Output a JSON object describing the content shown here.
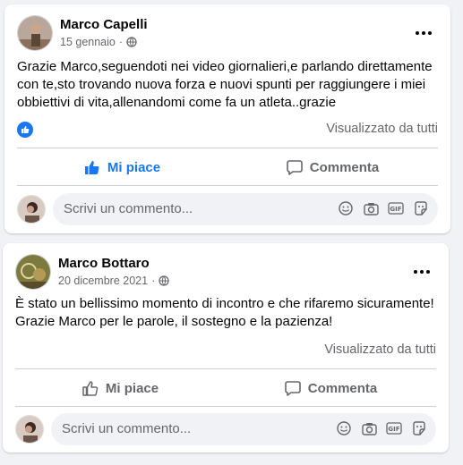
{
  "posts": [
    {
      "author": "Marco Capelli",
      "date": "15 gennaio",
      "privacy_icon": "globe-icon",
      "text": "Grazie Marco,seguendoti nei video giornalieri,e parlando direttamente con te,sto trovando nuova forza e nuovi spunti per raggiungere i miei obbiettivi di vita,allenandomi come fa un atleta..grazie",
      "reaction_icon": "like-icon",
      "seen_by": "Visualizzato da tutti",
      "like_label": "Mi piace",
      "like_active": true,
      "comment_label": "Commenta",
      "comment_placeholder": "Scrivi un commento..."
    },
    {
      "author": "Marco Bottaro",
      "date": "20 dicembre 2021",
      "privacy_icon": "globe-icon",
      "text": "È stato un bellissimo momento di incontro e che rifaremo sicuramente! Grazie Marco per le parole, il sostegno e la pazienza!",
      "seen_by": "Visualizzato da tutti",
      "like_label": "Mi piace",
      "like_active": false,
      "comment_label": "Commenta",
      "comment_placeholder": "Scrivi un commento..."
    }
  ],
  "comment_tools": [
    "smiley-icon",
    "camera-icon",
    "gif-icon",
    "sticker-icon"
  ],
  "colors": {
    "brand": "#1877f2",
    "muted": "#65676b",
    "background": "#f0f2f5"
  }
}
